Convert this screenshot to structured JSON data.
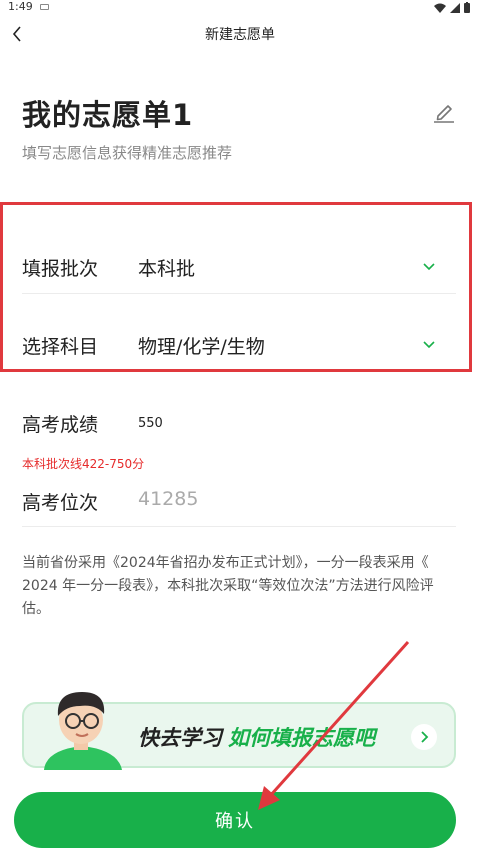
{
  "status_bar": {
    "time": "1:49"
  },
  "nav": {
    "title": "新建志愿单"
  },
  "header": {
    "title": "我的志愿单1",
    "subtitle": "填写志愿信息获得精准志愿推荐"
  },
  "form": {
    "batch": {
      "label": "填报批次",
      "value": "本科批"
    },
    "subjects": {
      "label": "选择科目",
      "value": "物理/化学/生物"
    },
    "score": {
      "label": "高考成绩",
      "value": "550",
      "hint": "本科批次线422-750分"
    },
    "rank": {
      "label": "高考位次",
      "placeholder": "41285"
    }
  },
  "notice": "当前省份采用《2024年省招办发布正式计划》，一分一段表采用《 2024 年一分一段表》，本科批次采取“等效位次法”方法进行风险评估。",
  "banner": {
    "text_part1": "快去学习",
    "text_part2": "如何填报志愿吧"
  },
  "footer": {
    "confirm_label": "确认"
  },
  "colors": {
    "accent": "#18b04a",
    "annotation": "#e0393e",
    "hint": "#e62b2b"
  }
}
